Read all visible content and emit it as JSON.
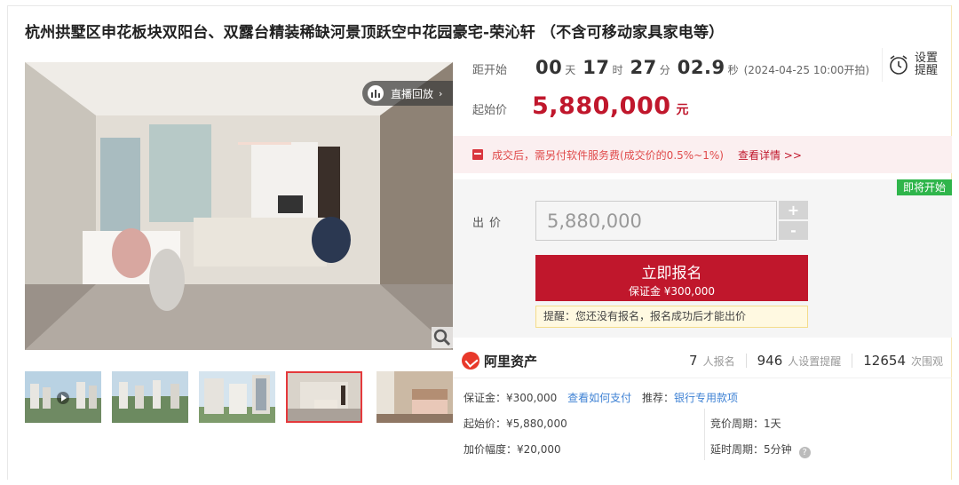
{
  "title": "杭州拱墅区申花板块双阳台、双露台精装稀缺河景顶跃空中花园豪宅-荣沁轩 （不含可移动家具家电等）",
  "gallery": {
    "live_label": "直播回放",
    "thumbnails": [
      "aerial-video",
      "aerial-view",
      "towers",
      "living-room",
      "bedroom"
    ],
    "active_index": 3
  },
  "countdown": {
    "label": "距开始",
    "days": "00",
    "days_unit": "天",
    "hours": "17",
    "hours_unit": "时",
    "minutes": "27",
    "minutes_unit": "分",
    "seconds": "02.9",
    "seconds_unit": "秒",
    "start_text": "(2024-04-25 10:00开拍)"
  },
  "reminder": {
    "label": "设置提醒"
  },
  "start_price": {
    "label": "起始价",
    "value": "5,880,000",
    "unit": "元"
  },
  "service_notice": {
    "text": "成交后，需另付软件服务费(成交价的0.5%~1%)",
    "link": "查看详情 >>"
  },
  "bid": {
    "status_badge": "即将开始",
    "label": "出价",
    "input_value": "5,880,000",
    "plus": "+",
    "minus": "-",
    "signup_label": "立即报名",
    "signup_deposit": "保证金 ¥300,000",
    "tip": "提醒：您还没有报名，报名成功后才能出价"
  },
  "stats": {
    "brand": "阿里资产",
    "registered_count": "7",
    "registered_label": "人报名",
    "reminders_count": "946",
    "reminders_label": "人设置提醒",
    "views_count": "12654",
    "views_label": "次围观"
  },
  "details": {
    "deposit": "保证金：¥300,000",
    "how_to_pay": "查看如何支付",
    "recommend_label": "推荐：",
    "recommend_link": "银行专用款项",
    "start_price": "起始价：¥5,880,000",
    "increment": "加价幅度：¥20,000",
    "bidding_cycle": "竞价周期：1天",
    "extension_cycle": "延时周期：5分钟"
  },
  "colors": {
    "accent": "#c0172c",
    "badge_green": "#2fb54b",
    "link_blue": "#3f82d4"
  }
}
